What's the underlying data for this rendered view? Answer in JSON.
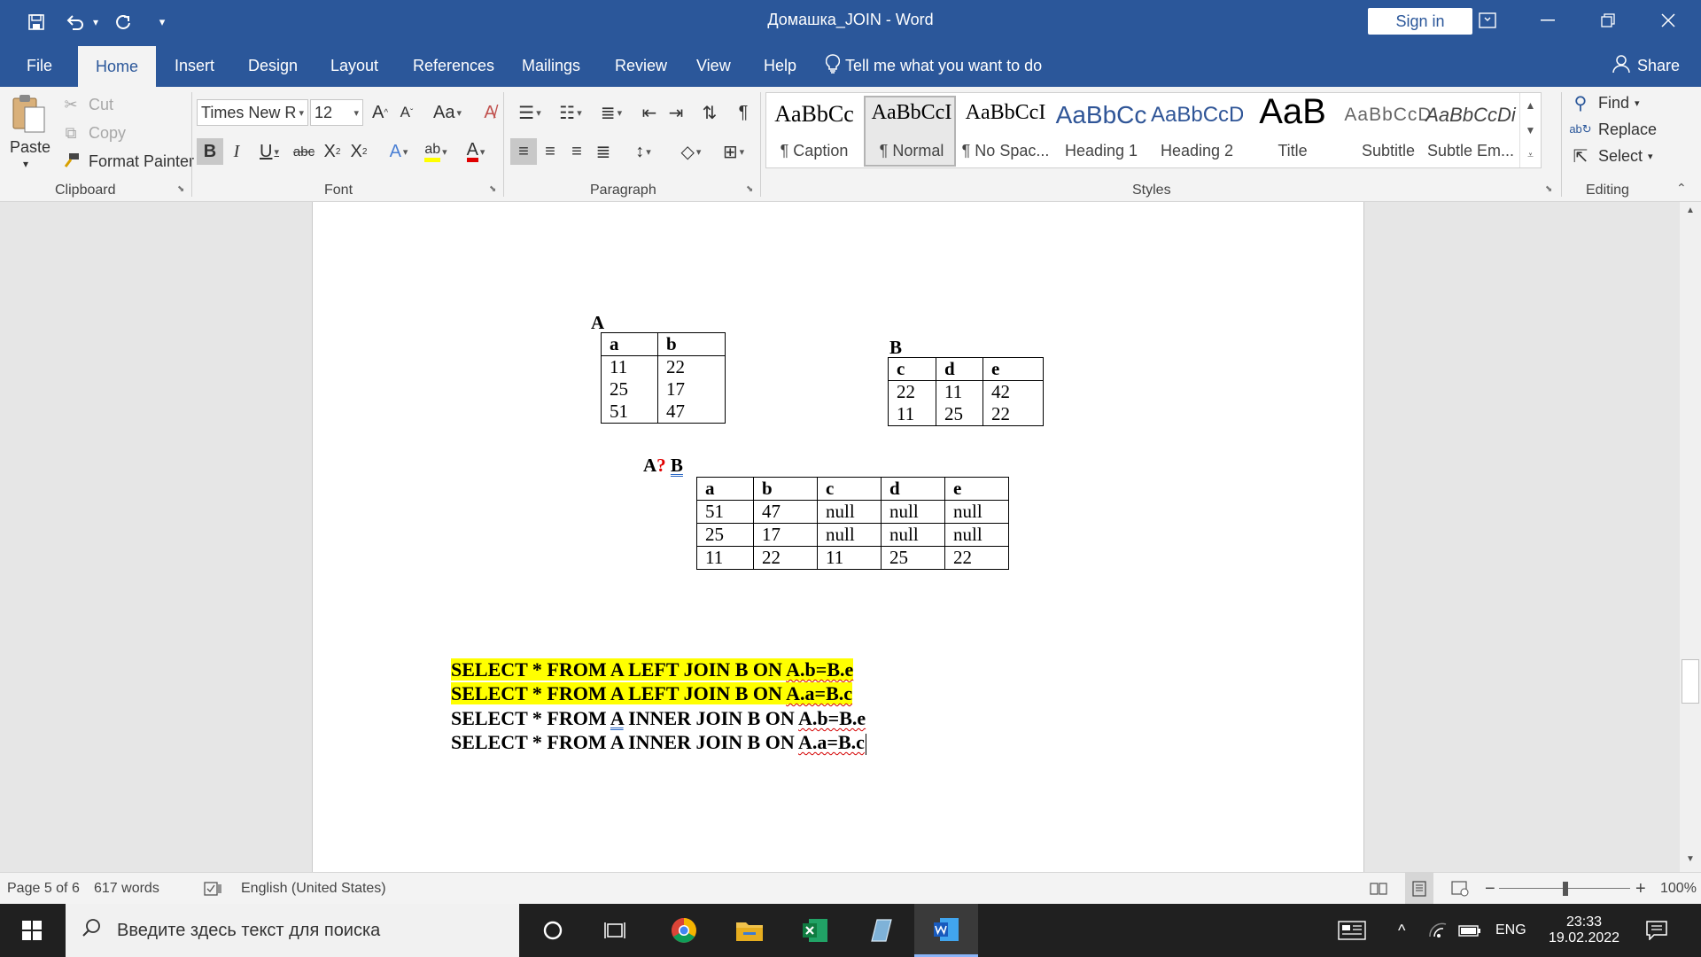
{
  "titlebar": {
    "title": "Домашка_JOIN  -  Word",
    "sign_in": "Sign in",
    "icons": [
      "save-icon",
      "undo-icon",
      "redo-icon",
      "customize-icon",
      "ribbon-display-icon",
      "minimize-icon",
      "restore-icon",
      "close-icon"
    ]
  },
  "tabs": [
    "File",
    "Home",
    "Insert",
    "Design",
    "Layout",
    "References",
    "Mailings",
    "Review",
    "View",
    "Help"
  ],
  "tell_me": "Tell me what you want to do",
  "share": "Share",
  "clipboard": {
    "paste": "Paste",
    "cut": "Cut",
    "copy": "Copy",
    "format_painter": "Format Painter",
    "label": "Clipboard"
  },
  "font": {
    "name": "Times New R",
    "size": "12",
    "label": "Font"
  },
  "paragraph": {
    "label": "Paragraph"
  },
  "styles": {
    "label": "Styles",
    "items": [
      {
        "sample": "AaBbCc",
        "name": "¶ Caption"
      },
      {
        "sample": "AaBbCcI",
        "name": "¶ Normal"
      },
      {
        "sample": "AaBbCcI",
        "name": "¶ No Spac..."
      },
      {
        "sample": "AaBbCc",
        "name": "Heading 1"
      },
      {
        "sample": "AaBbCcD",
        "name": "Heading 2"
      },
      {
        "sample": "AaB",
        "name": "Title"
      },
      {
        "sample": "AaBbCcD",
        "name": "Subtitle"
      },
      {
        "sample": "AaBbCcDi",
        "name": "Subtle Em..."
      }
    ]
  },
  "editing": {
    "find": "Find",
    "replace": "Replace",
    "select": "Select",
    "label": "Editing"
  },
  "document": {
    "table_a": {
      "label": "A",
      "headers": [
        "a",
        "b"
      ],
      "rows": [
        [
          "11",
          "22"
        ],
        [
          "25",
          "17"
        ],
        [
          "51",
          "47"
        ]
      ]
    },
    "table_b": {
      "label": "B",
      "headers": [
        "c",
        "d",
        "e"
      ],
      "rows": [
        [
          "22",
          "11",
          "42"
        ],
        [
          "11",
          "25",
          "22"
        ]
      ]
    },
    "result": {
      "label_a": "A",
      "label_q": "?",
      "label_b": "B",
      "headers": [
        "a",
        "b",
        "c",
        "d",
        "e"
      ],
      "rows": [
        [
          "51",
          "47",
          "null",
          "null",
          "null"
        ],
        [
          "25",
          "17",
          "null",
          "null",
          "null"
        ],
        [
          "11",
          "22",
          "11",
          "25",
          "22"
        ]
      ]
    },
    "queries": [
      {
        "main": "SELECT * FROM A LEFT JOIN B ON ",
        "cond": "A.b=B.e"
      },
      {
        "main": "SELECT * FROM A LEFT JOIN B ON ",
        "cond": "A.a=B.c"
      },
      {
        "pre": "SELECT * FROM ",
        "a": "A",
        "main": " INNER JOIN B ON ",
        "cond": "A.b=B.e"
      },
      {
        "main": "SELECT * FROM A INNER JOIN B ON ",
        "cond": "A.a=B.c"
      }
    ],
    "highlight_color": "#ffff00"
  },
  "statusbar": {
    "page": "Page 5 of 6",
    "words": "617 words",
    "language": "English (United States)",
    "zoom": "100%"
  },
  "taskbar": {
    "search_placeholder": "Введите здесь текст для поиска",
    "lang": "ENG",
    "time": "23:33",
    "date": "19.02.2022"
  }
}
